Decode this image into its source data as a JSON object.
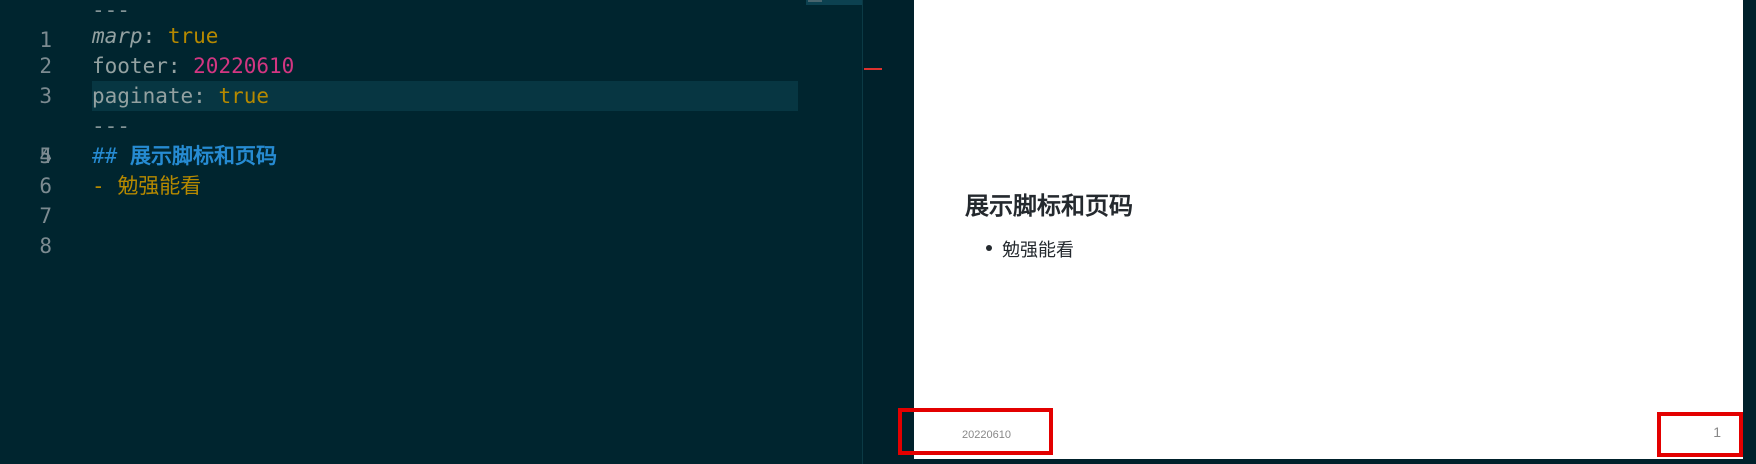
{
  "editor": {
    "lines": [
      {
        "num": "1",
        "dashes": "---"
      },
      {
        "num": "2",
        "key": "marp",
        "sep": ": ",
        "value": "true"
      },
      {
        "num": "3",
        "key": "footer",
        "sep": ": ",
        "value": "20220610"
      },
      {
        "num": "4",
        "key": "paginate",
        "sep": ": ",
        "value": "true"
      },
      {
        "num": "5",
        "dashes": "---"
      },
      {
        "num": "6",
        "hash": "##",
        "heading": "展示脚标和页码"
      },
      {
        "num": "7",
        "bullet": "-",
        "text": "勉强能看"
      },
      {
        "num": "8"
      }
    ]
  },
  "preview": {
    "heading": "展示脚标和页码",
    "bullets": [
      "勉强能看"
    ],
    "footer": "20220610",
    "page_number": "1"
  },
  "colors": {
    "editor_bg": "#00252f",
    "current_line": "#073642",
    "string_number": "#d33682",
    "boolean": "#b58900",
    "heading": "#268bd2",
    "annotation": "#e30000"
  }
}
